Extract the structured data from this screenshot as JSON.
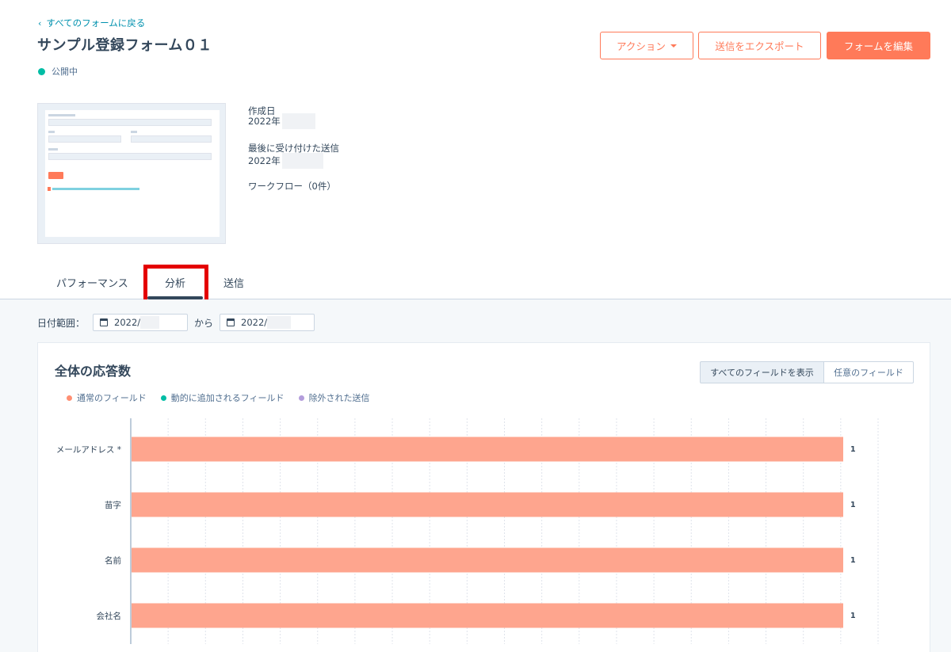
{
  "header": {
    "back_link": "すべてのフォームに戻る",
    "title": "サンプル登録フォーム０１",
    "status": "公開中",
    "status_color": "#00bda5"
  },
  "actions": {
    "action_label": "アクション",
    "export_label": "送信をエクスポート",
    "edit_label": "フォームを編集",
    "accent_color": "#ff7a59"
  },
  "meta": {
    "created_label": "作成日",
    "created_value": "2022年",
    "last_submission_label": "最後に受け付けた送信",
    "last_submission_value": "2022年",
    "workflow_label": "ワークフロー（0件）"
  },
  "tabs": [
    {
      "label": "パフォーマンス"
    },
    {
      "label": "分析"
    },
    {
      "label": "送信"
    }
  ],
  "date_range": {
    "label": "日付範囲：",
    "from_value": "2022/",
    "separator": "から",
    "to_value": "2022/"
  },
  "card": {
    "title": "全体の応答数",
    "toggle_all": "すべてのフィールドを表示",
    "toggle_optional": "任意のフィールド"
  },
  "legend": [
    {
      "label": "通常のフィールド",
      "color": "#ff8f73"
    },
    {
      "label": "動的に追加されるフィールド",
      "color": "#00bda5"
    },
    {
      "label": "除外された送信",
      "color": "#b39ddb"
    }
  ],
  "chart_data": {
    "type": "bar",
    "orientation": "horizontal",
    "categories": [
      "メールアドレス *",
      "苗字",
      "名前",
      "会社名"
    ],
    "values": [
      1,
      1,
      1,
      1
    ],
    "xlim": [
      0,
      1
    ],
    "grid": true,
    "bar_color": "#fea58e"
  }
}
